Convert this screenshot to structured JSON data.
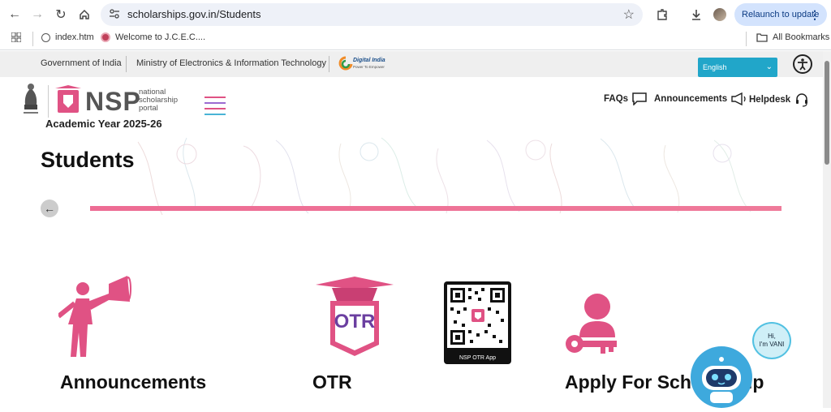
{
  "browser": {
    "url": "scholarships.gov.in/Students",
    "relaunch_label": "Relaunch to update",
    "bookmarks": [
      "index.htm",
      "Welcome to J.C.E.C...."
    ],
    "all_bookmarks": "All Bookmarks"
  },
  "gov_bar": {
    "gov": "Government of India",
    "ministry": "Ministry of Electronics & Information Technology",
    "digital_india": "Digital India",
    "digital_india_tag": "Power To Empower",
    "language": "English"
  },
  "header": {
    "logo_text": "NSP",
    "logo_sub": [
      "national",
      "scholarship",
      "portal"
    ],
    "academic_year": "Academic Year 2025-26",
    "nav": {
      "faqs": "FAQs",
      "announcements": "Announcements",
      "helpdesk": "Helpdesk"
    }
  },
  "page": {
    "title": "Students",
    "cards": [
      {
        "title": "Announcements"
      },
      {
        "title": "OTR",
        "icon_text": "OTR"
      },
      {
        "title": "Apply For Scholarship",
        "qr_label": "NSP OTR App"
      }
    ]
  },
  "chatbot": {
    "greeting_1": "Hi,",
    "greeting_2": "I'm VANI"
  },
  "colors": {
    "accent": "#e05284",
    "lang_bg": "#21a6c9",
    "relaunch_bg": "#d3e3fd"
  }
}
